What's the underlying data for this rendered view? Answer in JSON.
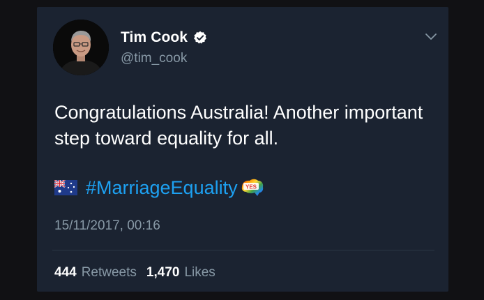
{
  "tweet": {
    "author": {
      "name": "Tim Cook",
      "handle": "@tim_cook",
      "verified": true
    },
    "text": "Congratulations Australia! Another important step toward equality for all.",
    "flag_emoji": "australia-flag-icon",
    "hashtag": "#MarriageEquality",
    "trailing_emoji": "yes-australia-emoji",
    "timestamp": "15/11/2017, 00:16",
    "stats": {
      "retweets_count": "444",
      "retweets_label": "Retweets",
      "likes_count": "1,470",
      "likes_label": "Likes"
    }
  },
  "colors": {
    "card_background": "#1b2331",
    "hashtag": "#1da1f2",
    "secondary_text": "#8899a6",
    "verified_badge": "#ffffff"
  }
}
